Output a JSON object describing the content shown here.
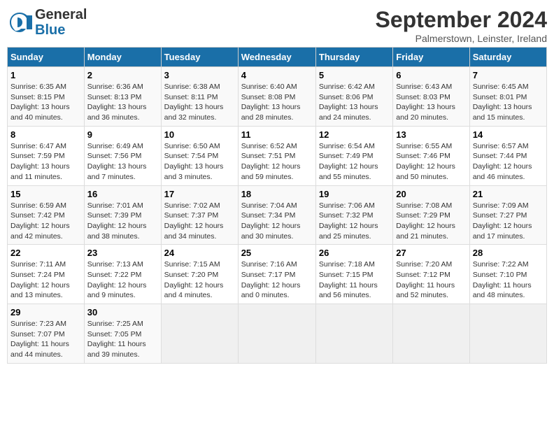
{
  "header": {
    "logo_general": "General",
    "logo_blue": "Blue",
    "month_title": "September 2024",
    "subtitle": "Palmerstown, Leinster, Ireland"
  },
  "weekdays": [
    "Sunday",
    "Monday",
    "Tuesday",
    "Wednesday",
    "Thursday",
    "Friday",
    "Saturday"
  ],
  "days": [
    {
      "num": "",
      "info": ""
    },
    {
      "num": "",
      "info": ""
    },
    {
      "num": "",
      "info": ""
    },
    {
      "num": "",
      "info": ""
    },
    {
      "num": "",
      "info": ""
    },
    {
      "num": "",
      "info": ""
    },
    {
      "num": "",
      "info": ""
    },
    {
      "num": "1",
      "info": "Sunrise: 6:35 AM\nSunset: 8:15 PM\nDaylight: 13 hours\nand 40 minutes."
    },
    {
      "num": "2",
      "info": "Sunrise: 6:36 AM\nSunset: 8:13 PM\nDaylight: 13 hours\nand 36 minutes."
    },
    {
      "num": "3",
      "info": "Sunrise: 6:38 AM\nSunset: 8:11 PM\nDaylight: 13 hours\nand 32 minutes."
    },
    {
      "num": "4",
      "info": "Sunrise: 6:40 AM\nSunset: 8:08 PM\nDaylight: 13 hours\nand 28 minutes."
    },
    {
      "num": "5",
      "info": "Sunrise: 6:42 AM\nSunset: 8:06 PM\nDaylight: 13 hours\nand 24 minutes."
    },
    {
      "num": "6",
      "info": "Sunrise: 6:43 AM\nSunset: 8:03 PM\nDaylight: 13 hours\nand 20 minutes."
    },
    {
      "num": "7",
      "info": "Sunrise: 6:45 AM\nSunset: 8:01 PM\nDaylight: 13 hours\nand 15 minutes."
    },
    {
      "num": "8",
      "info": "Sunrise: 6:47 AM\nSunset: 7:59 PM\nDaylight: 13 hours\nand 11 minutes."
    },
    {
      "num": "9",
      "info": "Sunrise: 6:49 AM\nSunset: 7:56 PM\nDaylight: 13 hours\nand 7 minutes."
    },
    {
      "num": "10",
      "info": "Sunrise: 6:50 AM\nSunset: 7:54 PM\nDaylight: 13 hours\nand 3 minutes."
    },
    {
      "num": "11",
      "info": "Sunrise: 6:52 AM\nSunset: 7:51 PM\nDaylight: 12 hours\nand 59 minutes."
    },
    {
      "num": "12",
      "info": "Sunrise: 6:54 AM\nSunset: 7:49 PM\nDaylight: 12 hours\nand 55 minutes."
    },
    {
      "num": "13",
      "info": "Sunrise: 6:55 AM\nSunset: 7:46 PM\nDaylight: 12 hours\nand 50 minutes."
    },
    {
      "num": "14",
      "info": "Sunrise: 6:57 AM\nSunset: 7:44 PM\nDaylight: 12 hours\nand 46 minutes."
    },
    {
      "num": "15",
      "info": "Sunrise: 6:59 AM\nSunset: 7:42 PM\nDaylight: 12 hours\nand 42 minutes."
    },
    {
      "num": "16",
      "info": "Sunrise: 7:01 AM\nSunset: 7:39 PM\nDaylight: 12 hours\nand 38 minutes."
    },
    {
      "num": "17",
      "info": "Sunrise: 7:02 AM\nSunset: 7:37 PM\nDaylight: 12 hours\nand 34 minutes."
    },
    {
      "num": "18",
      "info": "Sunrise: 7:04 AM\nSunset: 7:34 PM\nDaylight: 12 hours\nand 30 minutes."
    },
    {
      "num": "19",
      "info": "Sunrise: 7:06 AM\nSunset: 7:32 PM\nDaylight: 12 hours\nand 25 minutes."
    },
    {
      "num": "20",
      "info": "Sunrise: 7:08 AM\nSunset: 7:29 PM\nDaylight: 12 hours\nand 21 minutes."
    },
    {
      "num": "21",
      "info": "Sunrise: 7:09 AM\nSunset: 7:27 PM\nDaylight: 12 hours\nand 17 minutes."
    },
    {
      "num": "22",
      "info": "Sunrise: 7:11 AM\nSunset: 7:24 PM\nDaylight: 12 hours\nand 13 minutes."
    },
    {
      "num": "23",
      "info": "Sunrise: 7:13 AM\nSunset: 7:22 PM\nDaylight: 12 hours\nand 9 minutes."
    },
    {
      "num": "24",
      "info": "Sunrise: 7:15 AM\nSunset: 7:20 PM\nDaylight: 12 hours\nand 4 minutes."
    },
    {
      "num": "25",
      "info": "Sunrise: 7:16 AM\nSunset: 7:17 PM\nDaylight: 12 hours\nand 0 minutes."
    },
    {
      "num": "26",
      "info": "Sunrise: 7:18 AM\nSunset: 7:15 PM\nDaylight: 11 hours\nand 56 minutes."
    },
    {
      "num": "27",
      "info": "Sunrise: 7:20 AM\nSunset: 7:12 PM\nDaylight: 11 hours\nand 52 minutes."
    },
    {
      "num": "28",
      "info": "Sunrise: 7:22 AM\nSunset: 7:10 PM\nDaylight: 11 hours\nand 48 minutes."
    },
    {
      "num": "29",
      "info": "Sunrise: 7:23 AM\nSunset: 7:07 PM\nDaylight: 11 hours\nand 44 minutes."
    },
    {
      "num": "30",
      "info": "Sunrise: 7:25 AM\nSunset: 7:05 PM\nDaylight: 11 hours\nand 39 minutes."
    },
    {
      "num": "",
      "info": ""
    },
    {
      "num": "",
      "info": ""
    },
    {
      "num": "",
      "info": ""
    },
    {
      "num": "",
      "info": ""
    },
    {
      "num": "",
      "info": ""
    }
  ]
}
